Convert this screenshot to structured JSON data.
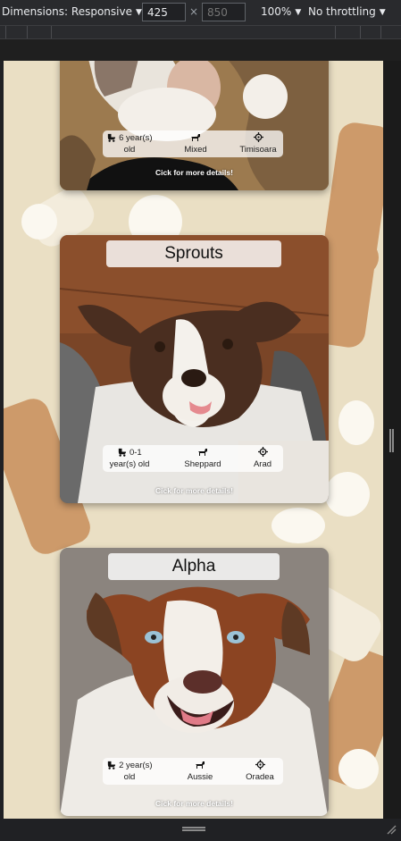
{
  "devtools": {
    "dimensions_label": "Dimensions: Responsive",
    "width_value": "425",
    "height_placeholder": "850",
    "times": "×",
    "zoom": "100%",
    "throttling": "No throttling"
  },
  "cards": [
    {
      "name": "",
      "age": "6 year(s) old",
      "age_line1": "6 year(s)",
      "age_line2": "old",
      "breed": "Mixed",
      "city": "Timisoara",
      "details": "Cick for more details!"
    },
    {
      "name": "Sprouts",
      "age": "0-1 year(s) old",
      "age_line1": "0-1",
      "age_line2": "year(s) old",
      "breed": "Sheppard",
      "city": "Arad",
      "details": "Cick for more details!"
    },
    {
      "name": "Alpha",
      "age": "2 year(s) old",
      "age_line1": "2 year(s)",
      "age_line2": "old",
      "breed": "Aussie",
      "city": "Oradea",
      "details": "Cick for more details!"
    }
  ],
  "icons": {
    "age": "stroller-icon",
    "breed": "dog-icon",
    "location": "location-target-icon"
  },
  "colors": {
    "background": "#eadfc4",
    "bone": "#cd9a6a",
    "devtools": "#292a2d"
  }
}
